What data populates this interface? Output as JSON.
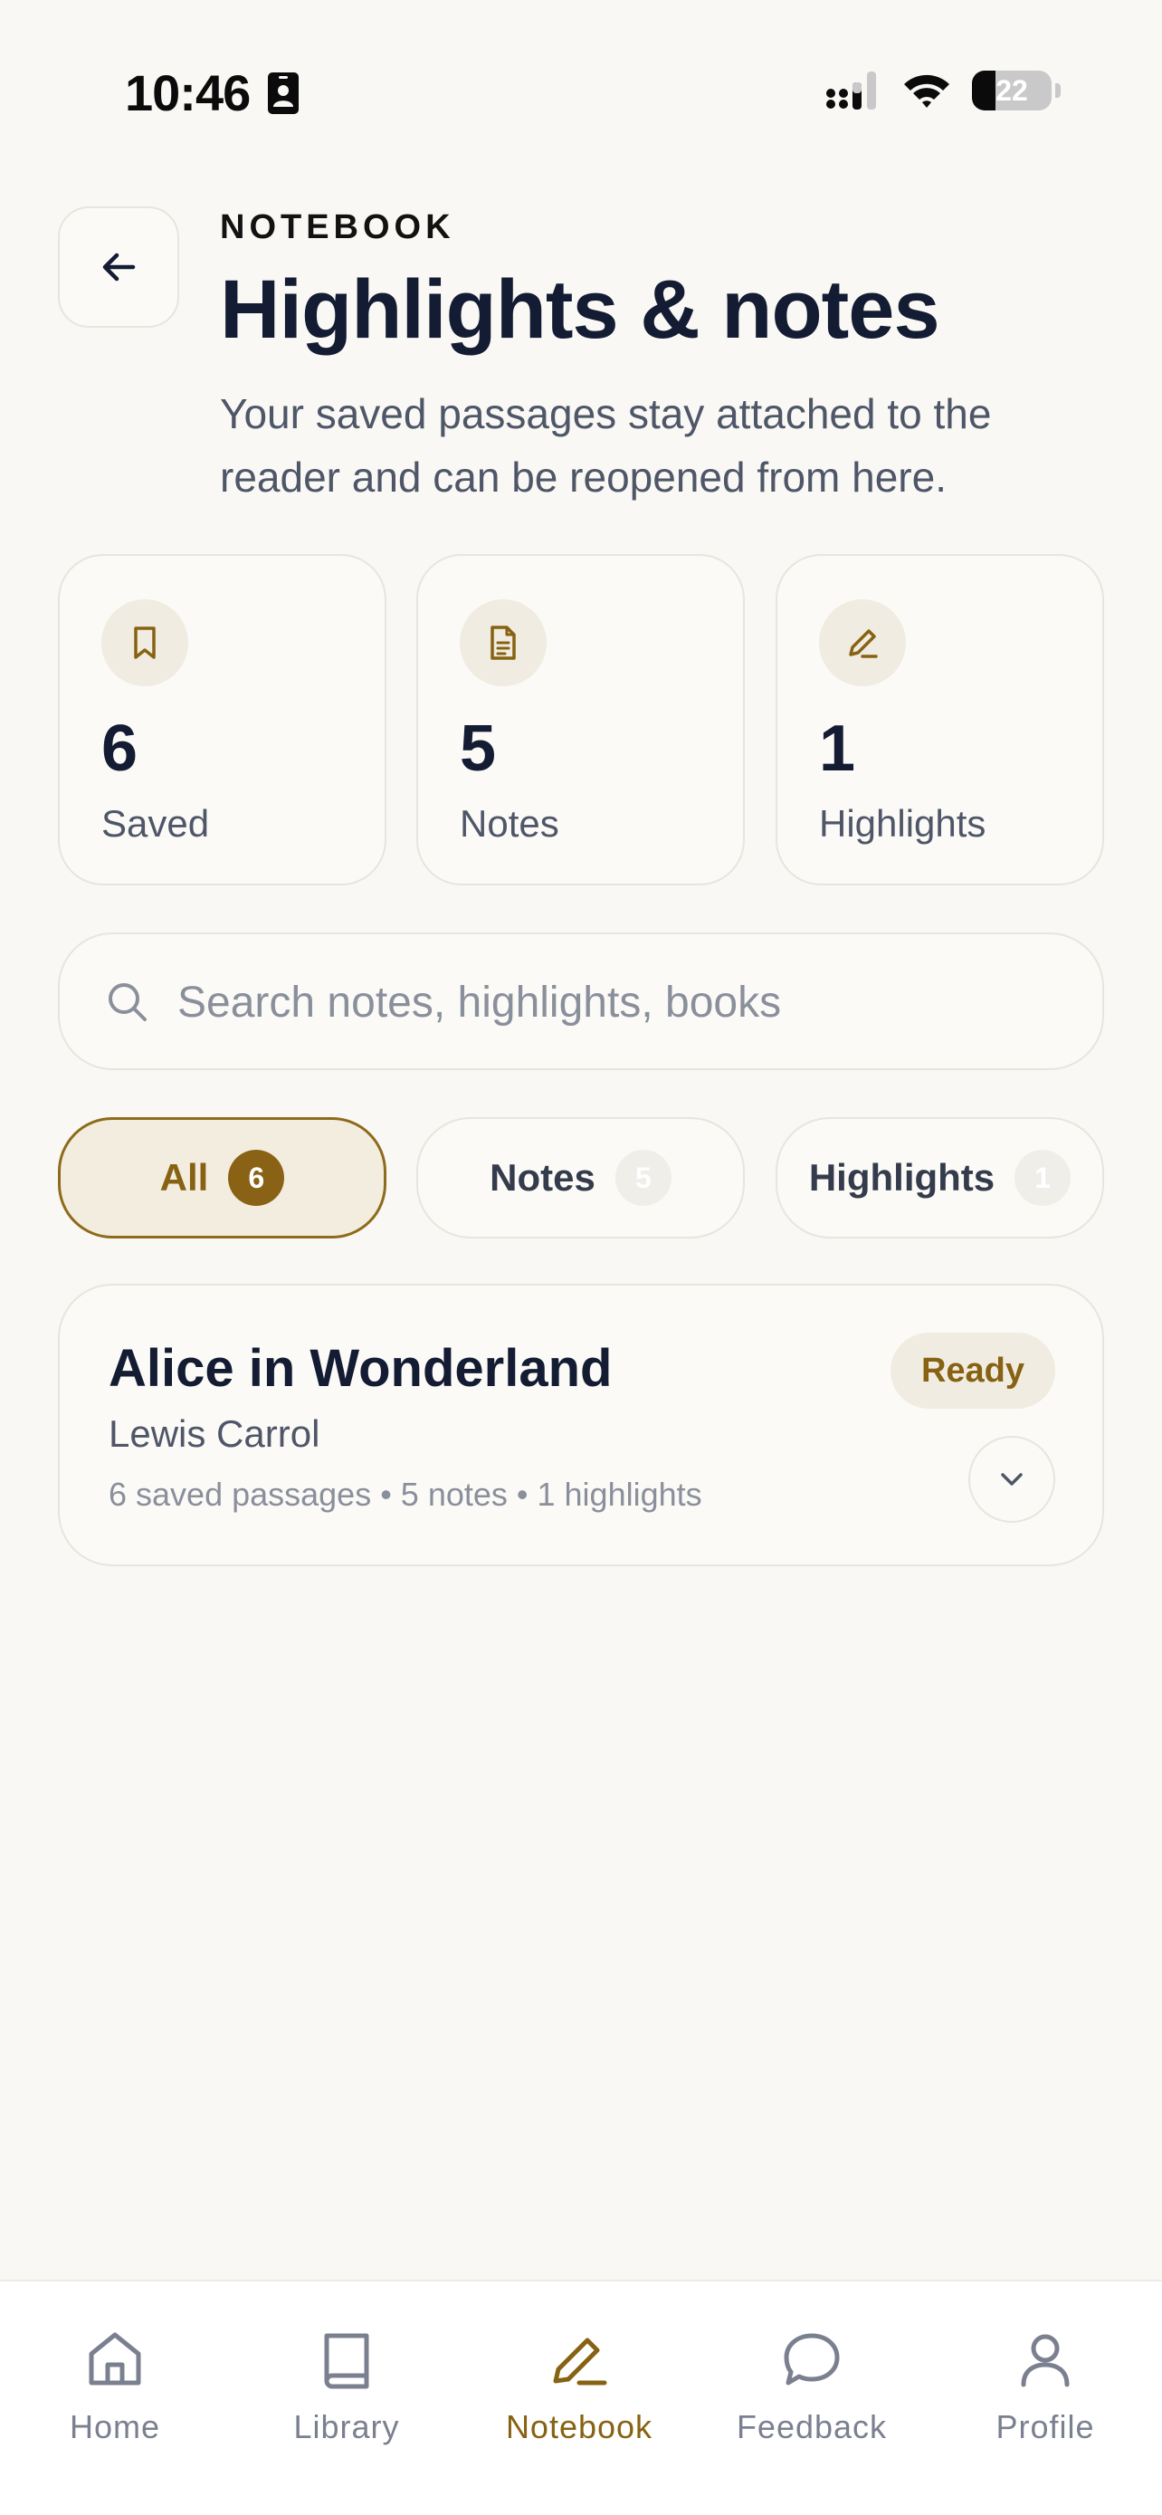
{
  "status_bar": {
    "time": "10:46",
    "battery": "22"
  },
  "header": {
    "eyebrow": "NOTEBOOK",
    "title": "Highlights & notes",
    "subtitle": "Your saved passages stay attached to the reader and can be reopened from here."
  },
  "stats": [
    {
      "icon": "bookmark-icon",
      "value": "6",
      "label": "Saved"
    },
    {
      "icon": "document-icon",
      "value": "5",
      "label": "Notes"
    },
    {
      "icon": "pencil-icon",
      "value": "1",
      "label": "Highlights"
    }
  ],
  "search": {
    "placeholder": "Search notes, highlights, books",
    "value": ""
  },
  "filters": [
    {
      "label": "All",
      "count": "6",
      "active": true
    },
    {
      "label": "Notes",
      "count": "5",
      "active": false
    },
    {
      "label": "Highlights",
      "count": "1",
      "active": false
    }
  ],
  "book": {
    "title": "Alice in Wonderland",
    "author": "Lewis Carrol",
    "meta": "6 saved passages • 5 notes • 1 highlights",
    "status": "Ready"
  },
  "nav": [
    {
      "label": "Home",
      "icon": "home-icon",
      "active": false
    },
    {
      "label": "Library",
      "icon": "book-icon",
      "active": false
    },
    {
      "label": "Notebook",
      "icon": "pencil-icon",
      "active": true
    },
    {
      "label": "Feedback",
      "icon": "chat-bubble-icon",
      "active": false
    },
    {
      "label": "Profile",
      "icon": "person-icon",
      "active": false
    }
  ],
  "colors": {
    "accent": "#876212",
    "background": "#f9f8f4",
    "text_primary": "#131c33",
    "text_secondary": "#4e5668",
    "text_muted": "#8a8f9c"
  }
}
